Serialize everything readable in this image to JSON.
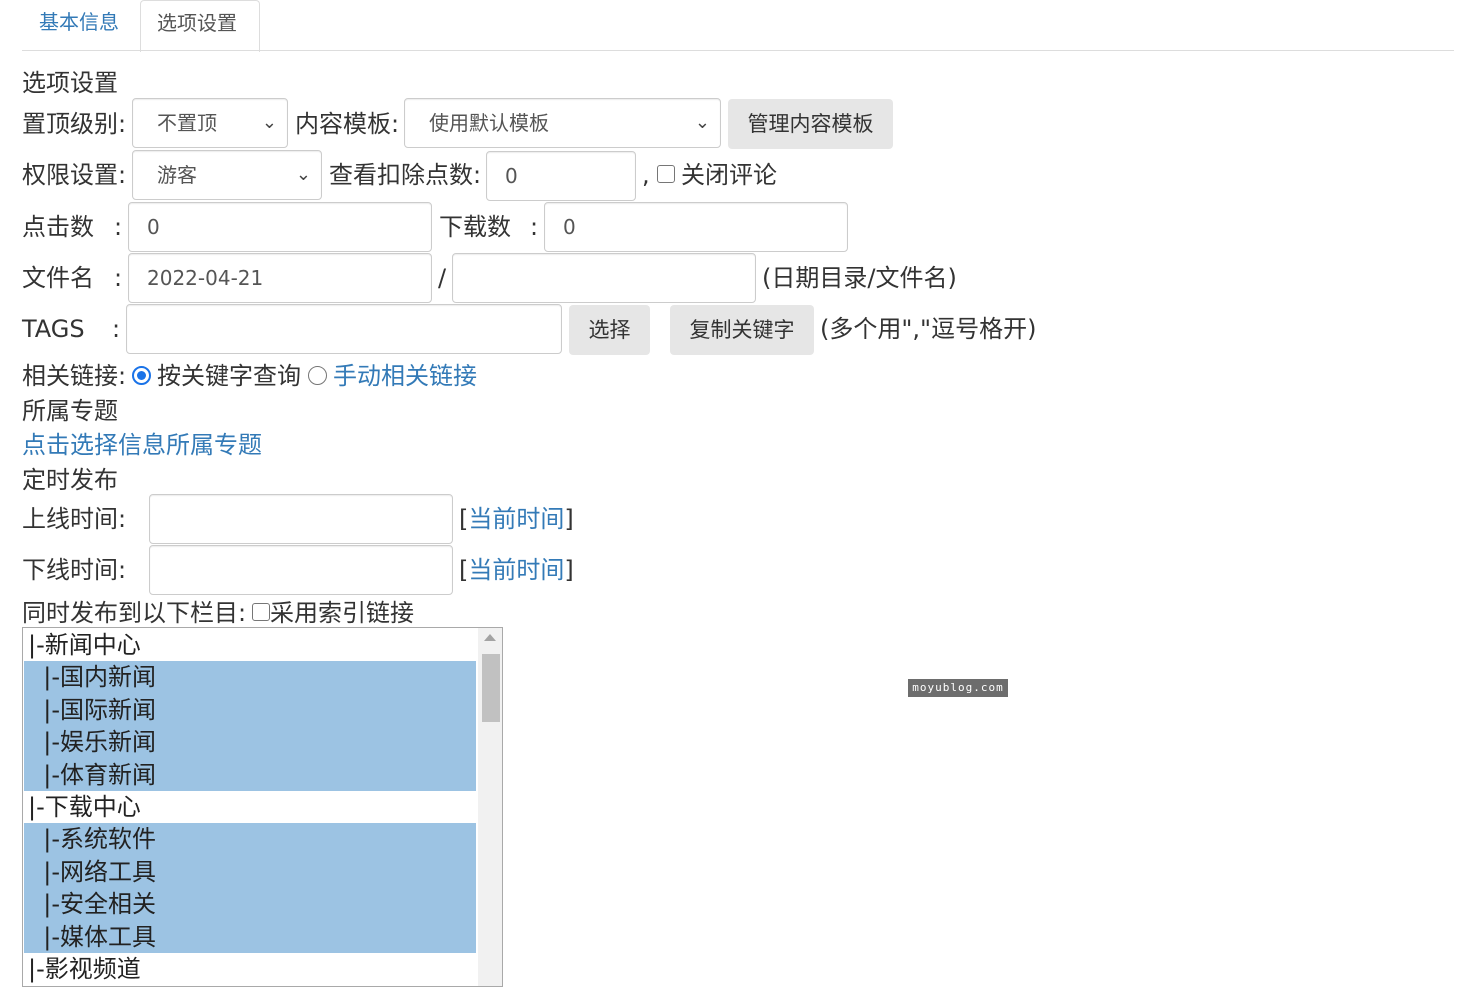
{
  "tabs": {
    "basic": "基本信息",
    "options": "选项设置"
  },
  "section_title": "选项设置",
  "top_level": {
    "label": "置顶级别:",
    "value": "不置顶"
  },
  "content_template": {
    "label": "内容模板:",
    "value": "使用默认模板",
    "manage_button": "管理内容模板"
  },
  "permission": {
    "label": "权限设置:",
    "value": "游客"
  },
  "view_deduct": {
    "label": "查看扣除点数:",
    "value": "0",
    "comma": ",",
    "close_comment_label": "关闭评论"
  },
  "clicks": {
    "label": "点击数",
    "colon": ":",
    "value": "0"
  },
  "downloads": {
    "label": "下载数",
    "colon": ":",
    "value": "0"
  },
  "filename": {
    "label": "文件名",
    "colon": ":",
    "date_value": "2022-04-21",
    "slash": "/",
    "name_value": "",
    "hint": "(日期目录/文件名)"
  },
  "tags": {
    "label": "TAGS",
    "colon": ":",
    "value": "",
    "select_button": "选择",
    "copy_button": "复制关键字",
    "hint": "(多个用\",\"逗号格开)"
  },
  "related_links": {
    "label": "相关链接:",
    "option_keyword": "按关键字查询",
    "option_manual": "手动相关链接"
  },
  "special_topic": {
    "title": "所属专题",
    "link": "点击选择信息所属专题"
  },
  "schedule": {
    "title": "定时发布",
    "online_label": "上线时间:",
    "offline_label": "下线时间:",
    "bracket_open": "[",
    "bracket_close": "]",
    "now_link": "当前时间"
  },
  "publish_to": {
    "label": "同时发布到以下栏目:",
    "index_link_label": "采用索引链接"
  },
  "columns": [
    {
      "text": "|-新闻中心",
      "selected": false
    },
    {
      "text": "  |-国内新闻",
      "selected": true
    },
    {
      "text": "  |-国际新闻",
      "selected": true
    },
    {
      "text": "  |-娱乐新闻",
      "selected": true
    },
    {
      "text": "  |-体育新闻",
      "selected": true
    },
    {
      "text": "|-下载中心",
      "selected": false
    },
    {
      "text": "  |-系统软件",
      "selected": true
    },
    {
      "text": "  |-网络工具",
      "selected": true
    },
    {
      "text": "  |-安全相关",
      "selected": true
    },
    {
      "text": "  |-媒体工具",
      "selected": true
    },
    {
      "text": "|-影视频道",
      "selected": false
    }
  ],
  "watermark": "moyublog.com",
  "colors": {
    "link": "#337ab7",
    "selection": "#9cc3e3",
    "button": "#e6e6e6",
    "border": "#cccccc"
  }
}
